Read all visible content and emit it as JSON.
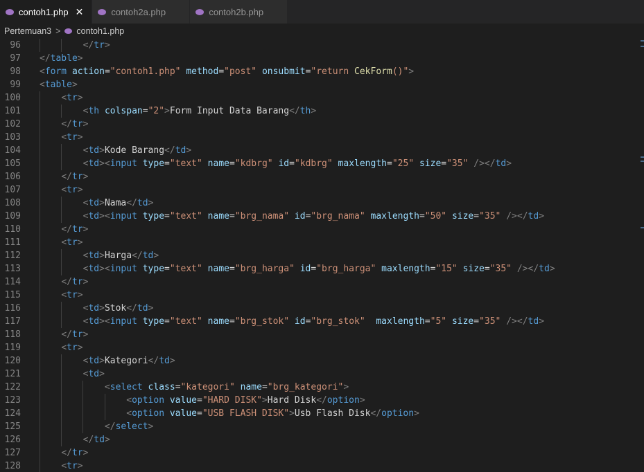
{
  "tabs": [
    {
      "label": "contoh1.php",
      "active": true
    },
    {
      "label": "contoh2a.php",
      "active": false
    },
    {
      "label": "contoh2b.php",
      "active": false
    }
  ],
  "breadcrumb": {
    "folder": "Pertemuan3",
    "file": "contoh1.php"
  },
  "lines": [
    {
      "n": "96",
      "tokens": [
        [
          "tg",
          "</"
        ],
        [
          "tn",
          "tr"
        ],
        [
          "tg",
          ">"
        ]
      ]
    },
    {
      "n": "97",
      "tokens": [
        [
          "tg",
          "</"
        ],
        [
          "tn",
          "table"
        ],
        [
          "tg",
          ">"
        ]
      ]
    },
    {
      "n": "98",
      "tokens": [
        [
          "tg",
          "<"
        ],
        [
          "tn",
          "form"
        ],
        [
          "tx",
          " "
        ],
        [
          "at",
          "action"
        ],
        [
          "tx",
          "="
        ],
        [
          "sv",
          "\"contoh1.php\""
        ],
        [
          "tx",
          " "
        ],
        [
          "at",
          "method"
        ],
        [
          "tx",
          "="
        ],
        [
          "sv",
          "\"post\""
        ],
        [
          "tx",
          " "
        ],
        [
          "at",
          "onsubmit"
        ],
        [
          "tx",
          "="
        ],
        [
          "sv",
          "\"return "
        ],
        [
          "fn",
          "CekForm"
        ],
        [
          "sv",
          "()\""
        ],
        [
          "tg",
          ">"
        ]
      ]
    },
    {
      "n": "99",
      "tokens": [
        [
          "tg",
          "<"
        ],
        [
          "tn",
          "table"
        ],
        [
          "tg",
          ">"
        ]
      ]
    },
    {
      "n": "100",
      "tokens": [
        [
          "tg",
          "<"
        ],
        [
          "tn",
          "tr"
        ],
        [
          "tg",
          ">"
        ]
      ]
    },
    {
      "n": "101",
      "tokens": [
        [
          "tg",
          "<"
        ],
        [
          "tn",
          "th"
        ],
        [
          "tx",
          " "
        ],
        [
          "at",
          "colspan"
        ],
        [
          "tx",
          "="
        ],
        [
          "sv",
          "\"2\""
        ],
        [
          "tg",
          ">"
        ],
        [
          "tx",
          "Form Input Data Barang"
        ],
        [
          "tg",
          "</"
        ],
        [
          "tn",
          "th"
        ],
        [
          "tg",
          ">"
        ]
      ]
    },
    {
      "n": "102",
      "tokens": [
        [
          "tg",
          "</"
        ],
        [
          "tn",
          "tr"
        ],
        [
          "tg",
          ">"
        ]
      ]
    },
    {
      "n": "103",
      "tokens": [
        [
          "tg",
          "<"
        ],
        [
          "tn",
          "tr"
        ],
        [
          "tg",
          ">"
        ]
      ]
    },
    {
      "n": "104",
      "tokens": [
        [
          "tg",
          "<"
        ],
        [
          "tn",
          "td"
        ],
        [
          "tg",
          ">"
        ],
        [
          "tx",
          "Kode Barang"
        ],
        [
          "tg",
          "</"
        ],
        [
          "tn",
          "td"
        ],
        [
          "tg",
          ">"
        ]
      ]
    },
    {
      "n": "105",
      "tokens": [
        [
          "tg",
          "<"
        ],
        [
          "tn",
          "td"
        ],
        [
          "tg",
          "><"
        ],
        [
          "tn",
          "input"
        ],
        [
          "tx",
          " "
        ],
        [
          "at",
          "type"
        ],
        [
          "tx",
          "="
        ],
        [
          "sv",
          "\"text\""
        ],
        [
          "tx",
          " "
        ],
        [
          "at",
          "name"
        ],
        [
          "tx",
          "="
        ],
        [
          "sv",
          "\"kdbrg\""
        ],
        [
          "tx",
          " "
        ],
        [
          "at",
          "id"
        ],
        [
          "tx",
          "="
        ],
        [
          "sv",
          "\"kdbrg\""
        ],
        [
          "tx",
          " "
        ],
        [
          "at",
          "maxlength"
        ],
        [
          "tx",
          "="
        ],
        [
          "sv",
          "\"25\""
        ],
        [
          "tx",
          " "
        ],
        [
          "at",
          "size"
        ],
        [
          "tx",
          "="
        ],
        [
          "sv",
          "\"35\""
        ],
        [
          "tx",
          " "
        ],
        [
          "tg",
          "/></"
        ],
        [
          "tn",
          "td"
        ],
        [
          "tg",
          ">"
        ]
      ]
    },
    {
      "n": "106",
      "tokens": [
        [
          "tg",
          "</"
        ],
        [
          "tn",
          "tr"
        ],
        [
          "tg",
          ">"
        ]
      ]
    },
    {
      "n": "107",
      "tokens": [
        [
          "tg",
          "<"
        ],
        [
          "tn",
          "tr"
        ],
        [
          "tg",
          ">"
        ]
      ]
    },
    {
      "n": "108",
      "tokens": [
        [
          "tg",
          "<"
        ],
        [
          "tn",
          "td"
        ],
        [
          "tg",
          ">"
        ],
        [
          "tx",
          "Nama"
        ],
        [
          "tg",
          "</"
        ],
        [
          "tn",
          "td"
        ],
        [
          "tg",
          ">"
        ]
      ]
    },
    {
      "n": "109",
      "tokens": [
        [
          "tg",
          "<"
        ],
        [
          "tn",
          "td"
        ],
        [
          "tg",
          "><"
        ],
        [
          "tn",
          "input"
        ],
        [
          "tx",
          " "
        ],
        [
          "at",
          "type"
        ],
        [
          "tx",
          "="
        ],
        [
          "sv",
          "\"text\""
        ],
        [
          "tx",
          " "
        ],
        [
          "at",
          "name"
        ],
        [
          "tx",
          "="
        ],
        [
          "sv",
          "\"brg_nama\""
        ],
        [
          "tx",
          " "
        ],
        [
          "at",
          "id"
        ],
        [
          "tx",
          "="
        ],
        [
          "sv",
          "\"brg_nama\""
        ],
        [
          "tx",
          " "
        ],
        [
          "at",
          "maxlength"
        ],
        [
          "tx",
          "="
        ],
        [
          "sv",
          "\"50\""
        ],
        [
          "tx",
          " "
        ],
        [
          "at",
          "size"
        ],
        [
          "tx",
          "="
        ],
        [
          "sv",
          "\"35\""
        ],
        [
          "tx",
          " "
        ],
        [
          "tg",
          "/></"
        ],
        [
          "tn",
          "td"
        ],
        [
          "tg",
          ">"
        ]
      ]
    },
    {
      "n": "110",
      "tokens": [
        [
          "tg",
          "</"
        ],
        [
          "tn",
          "tr"
        ],
        [
          "tg",
          ">"
        ]
      ]
    },
    {
      "n": "111",
      "tokens": [
        [
          "tg",
          "<"
        ],
        [
          "tn",
          "tr"
        ],
        [
          "tg",
          ">"
        ]
      ]
    },
    {
      "n": "112",
      "tokens": [
        [
          "tg",
          "<"
        ],
        [
          "tn",
          "td"
        ],
        [
          "tg",
          ">"
        ],
        [
          "tx",
          "Harga"
        ],
        [
          "tg",
          "</"
        ],
        [
          "tn",
          "td"
        ],
        [
          "tg",
          ">"
        ]
      ]
    },
    {
      "n": "113",
      "tokens": [
        [
          "tg",
          "<"
        ],
        [
          "tn",
          "td"
        ],
        [
          "tg",
          "><"
        ],
        [
          "tn",
          "input"
        ],
        [
          "tx",
          " "
        ],
        [
          "at",
          "type"
        ],
        [
          "tx",
          "="
        ],
        [
          "sv",
          "\"text\""
        ],
        [
          "tx",
          " "
        ],
        [
          "at",
          "name"
        ],
        [
          "tx",
          "="
        ],
        [
          "sv",
          "\"brg_harga\""
        ],
        [
          "tx",
          " "
        ],
        [
          "at",
          "id"
        ],
        [
          "tx",
          "="
        ],
        [
          "sv",
          "\"brg_harga\""
        ],
        [
          "tx",
          " "
        ],
        [
          "at",
          "maxlength"
        ],
        [
          "tx",
          "="
        ],
        [
          "sv",
          "\"15\""
        ],
        [
          "tx",
          " "
        ],
        [
          "at",
          "size"
        ],
        [
          "tx",
          "="
        ],
        [
          "sv",
          "\"35\""
        ],
        [
          "tx",
          " "
        ],
        [
          "tg",
          "/></"
        ],
        [
          "tn",
          "td"
        ],
        [
          "tg",
          ">"
        ]
      ]
    },
    {
      "n": "114",
      "tokens": [
        [
          "tg",
          "</"
        ],
        [
          "tn",
          "tr"
        ],
        [
          "tg",
          ">"
        ]
      ]
    },
    {
      "n": "115",
      "tokens": [
        [
          "tg",
          "<"
        ],
        [
          "tn",
          "tr"
        ],
        [
          "tg",
          ">"
        ]
      ]
    },
    {
      "n": "116",
      "tokens": [
        [
          "tg",
          "<"
        ],
        [
          "tn",
          "td"
        ],
        [
          "tg",
          ">"
        ],
        [
          "tx",
          "Stok"
        ],
        [
          "tg",
          "</"
        ],
        [
          "tn",
          "td"
        ],
        [
          "tg",
          ">"
        ]
      ]
    },
    {
      "n": "117",
      "tokens": [
        [
          "tg",
          "<"
        ],
        [
          "tn",
          "td"
        ],
        [
          "tg",
          "><"
        ],
        [
          "tn",
          "input"
        ],
        [
          "tx",
          " "
        ],
        [
          "at",
          "type"
        ],
        [
          "tx",
          "="
        ],
        [
          "sv",
          "\"text\""
        ],
        [
          "tx",
          " "
        ],
        [
          "at",
          "name"
        ],
        [
          "tx",
          "="
        ],
        [
          "sv",
          "\"brg_stok\""
        ],
        [
          "tx",
          " "
        ],
        [
          "at",
          "id"
        ],
        [
          "tx",
          "="
        ],
        [
          "sv",
          "\"brg_stok\""
        ],
        [
          "tx",
          "  "
        ],
        [
          "at",
          "maxlength"
        ],
        [
          "tx",
          "="
        ],
        [
          "sv",
          "\"5\""
        ],
        [
          "tx",
          " "
        ],
        [
          "at",
          "size"
        ],
        [
          "tx",
          "="
        ],
        [
          "sv",
          "\"35\""
        ],
        [
          "tx",
          " "
        ],
        [
          "tg",
          "/></"
        ],
        [
          "tn",
          "td"
        ],
        [
          "tg",
          ">"
        ]
      ]
    },
    {
      "n": "118",
      "tokens": [
        [
          "tg",
          "</"
        ],
        [
          "tn",
          "tr"
        ],
        [
          "tg",
          ">"
        ]
      ]
    },
    {
      "n": "119",
      "tokens": [
        [
          "tg",
          "<"
        ],
        [
          "tn",
          "tr"
        ],
        [
          "tg",
          ">"
        ]
      ]
    },
    {
      "n": "120",
      "tokens": [
        [
          "tg",
          "<"
        ],
        [
          "tn",
          "td"
        ],
        [
          "tg",
          ">"
        ],
        [
          "tx",
          "Kategori"
        ],
        [
          "tg",
          "</"
        ],
        [
          "tn",
          "td"
        ],
        [
          "tg",
          ">"
        ]
      ]
    },
    {
      "n": "121",
      "tokens": [
        [
          "tg",
          "<"
        ],
        [
          "tn",
          "td"
        ],
        [
          "tg",
          ">"
        ]
      ]
    },
    {
      "n": "122",
      "tokens": [
        [
          "tg",
          "<"
        ],
        [
          "tn",
          "select"
        ],
        [
          "tx",
          " "
        ],
        [
          "at",
          "class"
        ],
        [
          "tx",
          "="
        ],
        [
          "sv",
          "\"kategori\""
        ],
        [
          "tx",
          " "
        ],
        [
          "at",
          "name"
        ],
        [
          "tx",
          "="
        ],
        [
          "sv",
          "\"brg_kategori\""
        ],
        [
          "tg",
          ">"
        ]
      ]
    },
    {
      "n": "123",
      "tokens": [
        [
          "tg",
          "<"
        ],
        [
          "tn",
          "option"
        ],
        [
          "tx",
          " "
        ],
        [
          "at",
          "value"
        ],
        [
          "tx",
          "="
        ],
        [
          "sv",
          "\"HARD DISK\""
        ],
        [
          "tg",
          ">"
        ],
        [
          "tx",
          "Hard Disk"
        ],
        [
          "tg",
          "</"
        ],
        [
          "tn",
          "option"
        ],
        [
          "tg",
          ">"
        ]
      ]
    },
    {
      "n": "124",
      "tokens": [
        [
          "tg",
          "<"
        ],
        [
          "tn",
          "option"
        ],
        [
          "tx",
          " "
        ],
        [
          "at",
          "value"
        ],
        [
          "tx",
          "="
        ],
        [
          "sv",
          "\"USB FLASH DISK\""
        ],
        [
          "tg",
          ">"
        ],
        [
          "tx",
          "Usb Flash Disk"
        ],
        [
          "tg",
          "</"
        ],
        [
          "tn",
          "option"
        ],
        [
          "tg",
          ">"
        ]
      ]
    },
    {
      "n": "125",
      "tokens": [
        [
          "tg",
          "</"
        ],
        [
          "tn",
          "select"
        ],
        [
          "tg",
          ">"
        ]
      ]
    },
    {
      "n": "126",
      "tokens": [
        [
          "tg",
          "</"
        ],
        [
          "tn",
          "td"
        ],
        [
          "tg",
          ">"
        ]
      ]
    },
    {
      "n": "127",
      "tokens": [
        [
          "tg",
          "</"
        ],
        [
          "tn",
          "tr"
        ],
        [
          "tg",
          ">"
        ]
      ]
    },
    {
      "n": "128",
      "tokens": [
        [
          "tg",
          "<"
        ],
        [
          "tn",
          "tr"
        ],
        [
          "tg",
          ">"
        ]
      ]
    }
  ]
}
